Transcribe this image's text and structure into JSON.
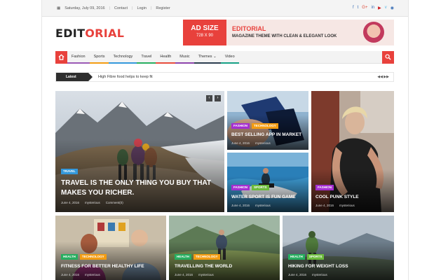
{
  "topbar": {
    "date": "Saturday, July 09, 2016",
    "links": [
      "Contact",
      "Login",
      "Register"
    ],
    "social_icons": [
      "facebook-icon",
      "twitter-icon",
      "google-plus-icon",
      "linkedin-icon",
      "youtube-icon",
      "vimeo-icon",
      "rss-icon"
    ],
    "social_glyphs": [
      "f",
      "t",
      "G+",
      "in",
      "▶",
      "v",
      "◉"
    ]
  },
  "logo": {
    "part1": "EDIT",
    "part2": "ORIAL"
  },
  "ad": {
    "size_title": "AD SIZE",
    "size_dims": "728 X 90",
    "headline": "EDITORIAL",
    "tagline": "MAGAZINE THEME WITH CLEAN & ELEGANT LOOK"
  },
  "nav": {
    "items": [
      "Fashion",
      "Sports",
      "Technology",
      "Travel",
      "Health",
      "Music",
      "Themes ⌄",
      "Video"
    ],
    "underline_colors": [
      "#9b59b6",
      "#f39c12",
      "#3498db",
      "#27ae60",
      "#e74c3c",
      "#8e44ad",
      "#2c3e50",
      "#16a085"
    ]
  },
  "ticker": {
    "label": "Latest",
    "headline": "High Fibre food helps to keep fit",
    "arrows": "◀◀  ▶▶"
  },
  "colors": {
    "accent": "#e8413c",
    "fashion": "#a52fd1",
    "technology": "#f39c12",
    "travel": "#3498db",
    "sports": "#6cbb3c",
    "health": "#27ae60"
  },
  "cards": {
    "main": {
      "tags": [
        "TRAVEL"
      ],
      "title": "TRAVEL IS THE ONLY THING YOU BUY THAT MAKES YOU RICHER.",
      "date": "June 4, 2016",
      "author": "mysterious",
      "comments": "Comment(0)"
    },
    "app": {
      "tags": [
        "FASHION",
        "TECHNOLOGY"
      ],
      "title": "BEST SELLING APP IN MARKET",
      "date": "June 4, 2016",
      "author": "mysterious"
    },
    "water": {
      "tags": [
        "FASHION",
        "SPORTS"
      ],
      "title": "WATER SPORT IS FUN GAME",
      "date": "June 4, 2016",
      "author": "mysterious"
    },
    "punk": {
      "tags": [
        "FASHION"
      ],
      "title": "COOL PUNK STYLE",
      "date": "June 4, 2016",
      "author": "mysterious"
    },
    "fitness": {
      "tags": [
        "HEALTH",
        "TECHNOLOGY"
      ],
      "title": "FITNESS FOR BETTER HEALTHY LIFE",
      "date": "June 4, 2016",
      "author": "mysterious"
    },
    "travelling": {
      "tags": [
        "HEALTH",
        "TECHNOLOGY"
      ],
      "title": "TRAVELLING THE WORLD",
      "date": "June 4, 2016",
      "author": "mysterious"
    },
    "hiking": {
      "tags": [
        "HEALTH",
        "SPORTS"
      ],
      "title": "HIKING FOR WEIGHT LOSS",
      "date": "June 4, 2016",
      "author": "mysterious"
    }
  }
}
